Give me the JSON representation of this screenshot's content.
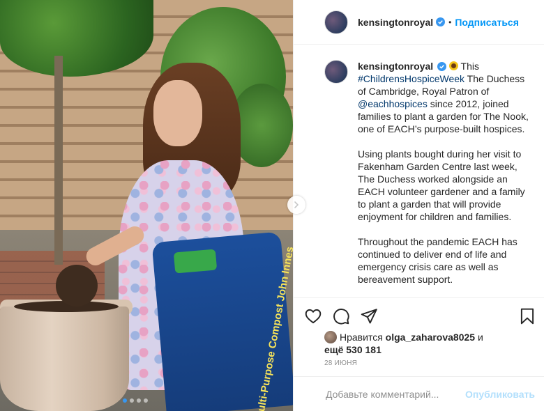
{
  "header": {
    "username": "kensingtonroyal",
    "separator": "•",
    "follow_label": "Подписаться"
  },
  "caption": {
    "username": "kensingtonroyal",
    "p1_intro": " This ",
    "p1_hashtag": "#ChildrensHospiceWeek",
    "p1_mid": " The Duchess of Cambridge, Royal Patron of ",
    "p1_mention": "@eachhospices",
    "p1_end": " since 2012, joined families to plant a garden for The Nook, one of EACH’s purpose-built hospices.",
    "p2": "Using plants bought during her visit to Fakenham Garden Centre last week, The Duchess worked alongside an EACH volunteer gardener and a family to plant a garden that will provide enjoyment for children and families.",
    "p3": "Throughout the pandemic EACH has continued to deliver end of life and emergency crisis care as well as bereavement support."
  },
  "media": {
    "bag_text": "Multi-Purpose Compost John Innes",
    "slide_count": 4,
    "active_slide": 0
  },
  "icons": {
    "like": "heart-icon",
    "comment": "comment-icon",
    "share": "paper-plane-icon",
    "save": "bookmark-icon",
    "next": "chevron-right-icon",
    "verified": "verified-badge-icon"
  },
  "likes": {
    "prefix": "Нравится ",
    "user": "olga_zaharova8025",
    "and": " и",
    "more": "ещё 530 181"
  },
  "date": "28 ИЮНЯ",
  "comment": {
    "placeholder": "Добавьте комментарий...",
    "publish_label": "Опубликовать"
  },
  "colors": {
    "accent": "#0095f6",
    "verified": "#3897f0",
    "publish_disabled": "#b2dffc"
  }
}
